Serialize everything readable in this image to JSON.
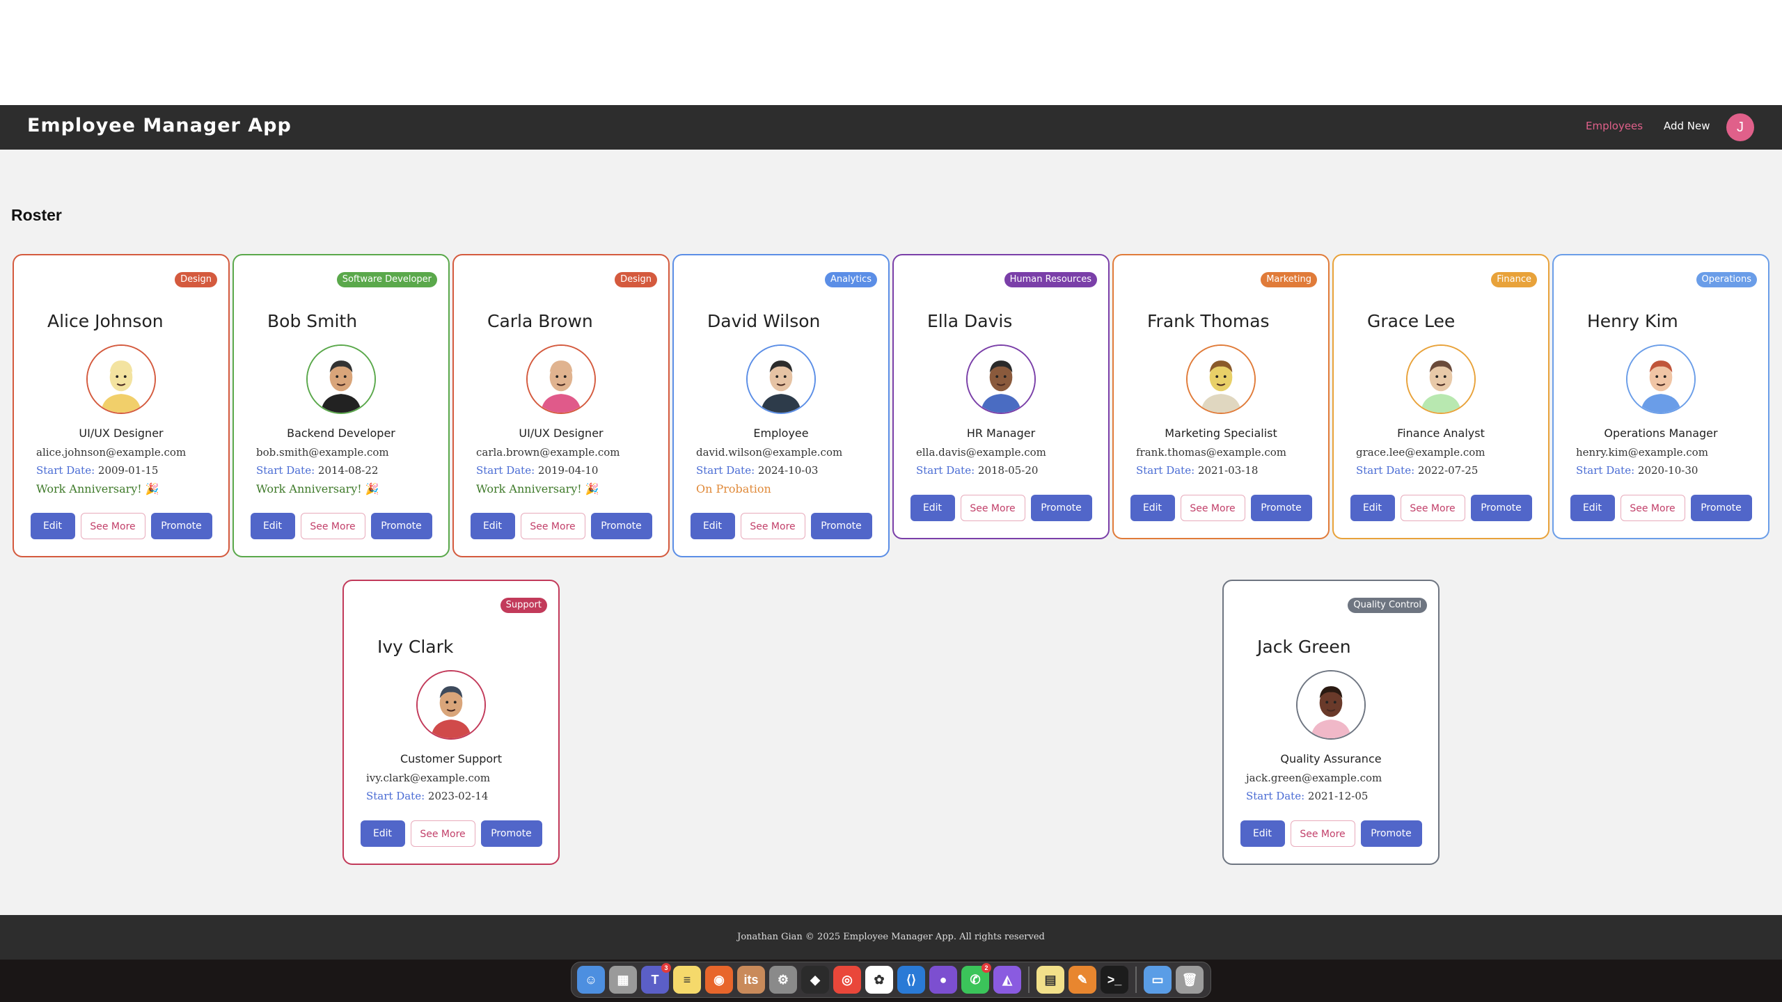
{
  "app": {
    "title": "Employee Manager App"
  },
  "nav": {
    "employees": "Employees",
    "add_new": "Add New",
    "avatar_initial": "J",
    "active_color": "#e0608a"
  },
  "page": {
    "heading": "Roster"
  },
  "buttons": {
    "edit": "Edit",
    "see_more": "See More",
    "promote": "Promote"
  },
  "labels": {
    "start_date": "Start Date:"
  },
  "employees": [
    {
      "name": "Alice Johnson",
      "department": "Design",
      "role": "UI/UX Designer",
      "email": "alice.johnson@example.com",
      "start_date": "2009-01-15",
      "note": "Work Anniversary! 🎉",
      "color": "#d45a3e",
      "avatar": "blonde-character-avatar"
    },
    {
      "name": "Bob Smith",
      "department": "Software Developer",
      "role": "Backend Developer",
      "email": "bob.smith@example.com",
      "start_date": "2014-08-22",
      "note": "Work Anniversary! 🎉",
      "color": "#5aa84b",
      "avatar": "smiling-man-avatar"
    },
    {
      "name": "Carla Brown",
      "department": "Design",
      "role": "UI/UX Designer",
      "email": "carla.brown@example.com",
      "start_date": "2019-04-10",
      "note": "Work Anniversary! 🎉",
      "color": "#d45a3e",
      "avatar": "bald-person-avatar"
    },
    {
      "name": "David Wilson",
      "department": "Analytics",
      "role": "Employee",
      "email": "david.wilson@example.com",
      "start_date": "2024-10-03",
      "note": "On Probation",
      "color": "#5b8ee6",
      "avatar": "mustache-man-avatar"
    },
    {
      "name": "Ella Davis",
      "department": "Human Resources",
      "role": "HR Manager",
      "email": "ella.davis@example.com",
      "start_date": "2018-05-20",
      "note": "",
      "color": "#7a3fa8",
      "avatar": "overalls-person-avatar"
    },
    {
      "name": "Frank Thomas",
      "department": "Marketing",
      "role": "Marketing Specialist",
      "email": "frank.thomas@example.com",
      "start_date": "2021-03-18",
      "note": "",
      "color": "#e07b39",
      "avatar": "curly-hair-avatar"
    },
    {
      "name": "Grace Lee",
      "department": "Finance",
      "role": "Finance Analyst",
      "email": "grace.lee@example.com",
      "start_date": "2022-07-25",
      "note": "",
      "color": "#e8a23a",
      "avatar": "bearded-man-avatar"
    },
    {
      "name": "Henry Kim",
      "department": "Operations",
      "role": "Operations Manager",
      "email": "henry.kim@example.com",
      "start_date": "2020-10-30",
      "note": "",
      "color": "#6a9de8",
      "avatar": "red-beard-avatar"
    },
    {
      "name": "Ivy Clark",
      "department": "Support",
      "role": "Customer Support",
      "email": "ivy.clark@example.com",
      "start_date": "2023-02-14",
      "note": "",
      "color": "#c23a5a",
      "avatar": "turban-man-avatar"
    },
    {
      "name": "Jack Green",
      "department": "Quality Control",
      "role": "Quality Assurance",
      "email": "jack.green@example.com",
      "start_date": "2021-12-05",
      "note": "",
      "color": "#6e7581",
      "avatar": "long-hair-woman-avatar"
    }
  ],
  "note_colors": {
    "anniversary": "#3f7a2a",
    "probation": "#e08a3a"
  },
  "footer": {
    "text": "Jonathan Gian © 2025 Employee Manager App. All rights reserved"
  },
  "dock": {
    "items": [
      {
        "icon": "finder-icon",
        "color": "#4d8fe0",
        "glyph": "☺"
      },
      {
        "icon": "launchpad-icon",
        "color": "#9a9a9a",
        "glyph": "▦"
      },
      {
        "icon": "teams-icon",
        "color": "#5b5fc7",
        "glyph": "T",
        "badge": "3"
      },
      {
        "icon": "notes-icon",
        "color": "#f5d96b",
        "glyph": "≡"
      },
      {
        "icon": "firefox-icon",
        "color": "#e8662b",
        "glyph": "◉"
      },
      {
        "icon": "its-icon",
        "color": "#c98a5a",
        "glyph": "its"
      },
      {
        "icon": "settings-icon",
        "color": "#8a8a8a",
        "glyph": "⚙"
      },
      {
        "icon": "figma-icon",
        "color": "#2b2b2b",
        "glyph": "◆"
      },
      {
        "icon": "chrome-icon",
        "color": "#e9473a",
        "glyph": "◎"
      },
      {
        "icon": "openai-icon",
        "color": "#ffffff",
        "glyph": "✿"
      },
      {
        "icon": "vscode-icon",
        "color": "#2a7ad6",
        "glyph": "⟨⟩"
      },
      {
        "icon": "github-icon",
        "color": "#7c4fd0",
        "glyph": "●"
      },
      {
        "icon": "whatsapp-icon",
        "color": "#3bc45a",
        "glyph": "✆",
        "badge": "2"
      },
      {
        "icon": "perplexity-icon",
        "color": "#8a5be0",
        "glyph": "◭"
      },
      {
        "icon": "stickies-icon",
        "color": "#f2e08a",
        "glyph": "▤"
      },
      {
        "icon": "pencil-app-icon",
        "color": "#e8862f",
        "glyph": "✎"
      },
      {
        "icon": "terminal-icon",
        "color": "#1c1c1c",
        "glyph": ">_"
      },
      {
        "icon": "folder-icon",
        "color": "#5a9de6",
        "glyph": "▭"
      },
      {
        "icon": "trash-icon",
        "color": "#9c9c9c",
        "glyph": "🗑"
      }
    ]
  }
}
